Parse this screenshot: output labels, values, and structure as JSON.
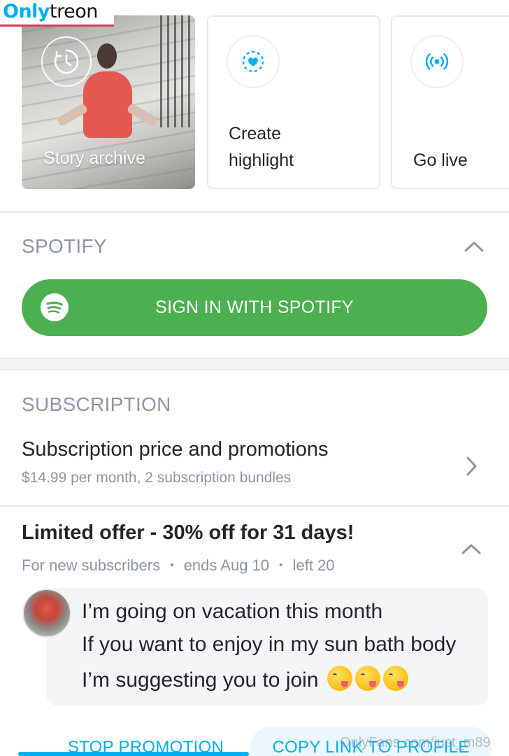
{
  "watermark_logo": {
    "part1": "Only",
    "part2": "treon"
  },
  "highlights": {
    "story_archive": {
      "label": "Story archive",
      "icon": "clock-history-icon"
    },
    "create_highlight": {
      "line1": "Create",
      "line2": "highlight",
      "icon": "heart-circle-icon"
    },
    "go_live": {
      "label": "Go live",
      "icon": "broadcast-icon"
    }
  },
  "spotify": {
    "heading": "SPOTIFY",
    "sign_in_label": "SIGN IN WITH SPOTIFY",
    "button_color": "#4caf50"
  },
  "subscription": {
    "heading": "SUBSCRIPTION",
    "row_title": "Subscription price and promotions",
    "row_desc": "$14.99 per month, 2 subscription bundles"
  },
  "offer": {
    "title": "Limited offer - 30% off for 31 days!",
    "audience": "For new subscribers",
    "ends": "ends Aug 10",
    "left": "left 20",
    "separator": "•",
    "message_lines": [
      "I’m going on vacation this month",
      "If you want to enjoy in my sun bath body",
      "I’m suggesting you to join"
    ],
    "emoji_count": 3
  },
  "actions": {
    "stop_label": "STOP PROMOTION",
    "copy_label": "COPY LINK TO PROFILE"
  },
  "footer_watermark": "OnlyFans.com/just_m89",
  "colors": {
    "accent": "#00aff0",
    "muted": "#8a96a3",
    "text": "#242529"
  }
}
